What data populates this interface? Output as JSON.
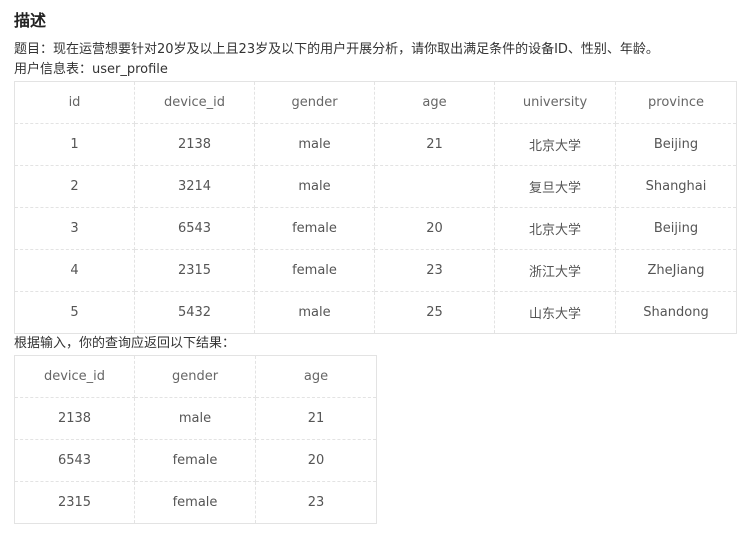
{
  "heading": "描述",
  "question": "题目：现在运营想要针对20岁及以上且23岁及以下的用户开展分析，请你取出满足条件的设备ID、性别、年龄。",
  "table_intro": "用户信息表：user_profile",
  "input_table": {
    "columns": [
      "id",
      "device_id",
      "gender",
      "age",
      "university",
      "province"
    ],
    "rows": [
      [
        "1",
        "2138",
        "male",
        "21",
        "北京大学",
        "Beijing"
      ],
      [
        "2",
        "3214",
        "male",
        "",
        "复旦大学",
        "Shanghai"
      ],
      [
        "3",
        "6543",
        "female",
        "20",
        "北京大学",
        "Beijing"
      ],
      [
        "4",
        "2315",
        "female",
        "23",
        "浙江大学",
        "ZheJiang"
      ],
      [
        "5",
        "5432",
        "male",
        "25",
        "山东大学",
        "Shandong"
      ]
    ]
  },
  "result_intro": "根据输入，你的查询应返回以下结果：",
  "result_table": {
    "columns": [
      "device_id",
      "gender",
      "age"
    ],
    "rows": [
      [
        "2138",
        "male",
        "21"
      ],
      [
        "6543",
        "female",
        "20"
      ],
      [
        "2315",
        "female",
        "23"
      ]
    ]
  }
}
